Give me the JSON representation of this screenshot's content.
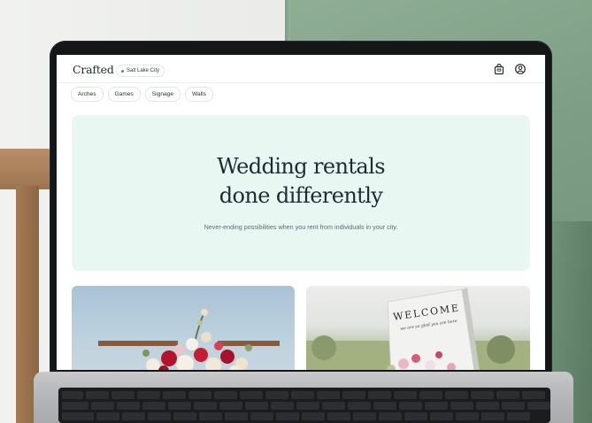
{
  "app": {
    "logo": "Crafted",
    "location": "Salt Lake City"
  },
  "header_icons": {
    "cart": "shopping-bag-icon",
    "account": "user-account-icon"
  },
  "categories": [
    "Arches",
    "Games",
    "Signage",
    "Walls"
  ],
  "hero": {
    "title_line1": "Wedding rentals",
    "title_line2": "done differently",
    "subtitle": "Never-ending possibilities when you rent from individuals in your city."
  },
  "cards": [
    {
      "image": "floral-arch-photo"
    },
    {
      "image": "welcome-sign-photo",
      "sign_title": "WELCOME",
      "sign_script": "we are so glad you are here"
    }
  ],
  "colors": {
    "hero_bg": "#e9f7f3",
    "text_dark": "#1e2b30",
    "accent_dot": "#2a9d7c"
  }
}
